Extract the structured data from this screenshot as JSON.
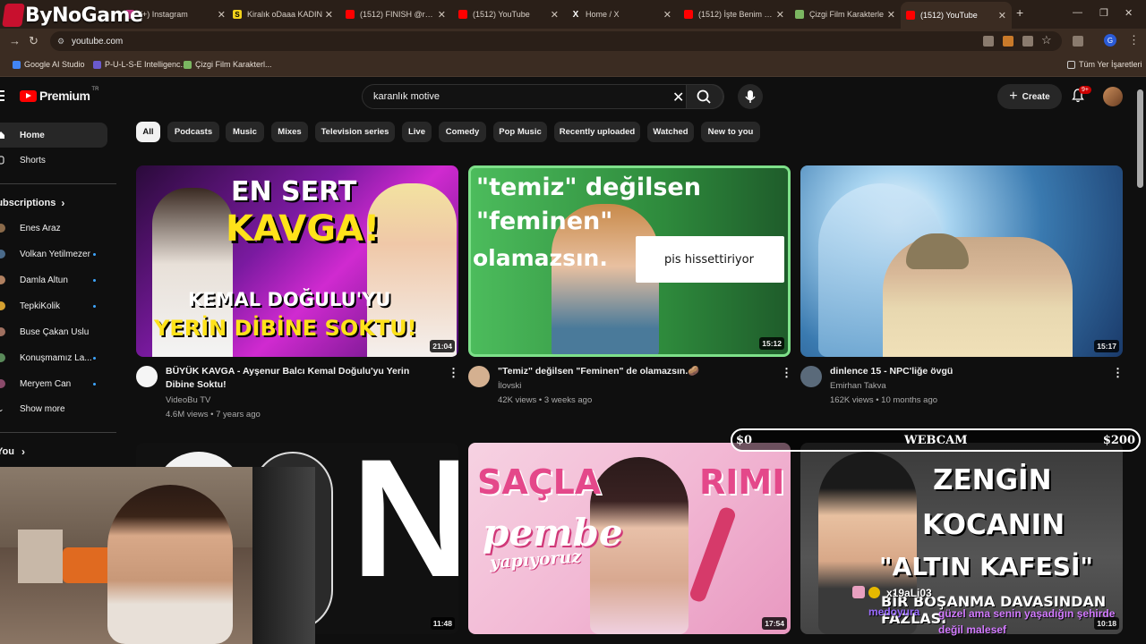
{
  "overlay_logo": "ByNoGame",
  "browser": {
    "tabs": [
      {
        "label": "(+) Instagram",
        "icon": "instagram-icon"
      },
      {
        "label": "Kiralık oDaaa KADIN",
        "icon": "s-icon"
      },
      {
        "label": "(1512) FINISH @rosel",
        "icon": "youtube-icon"
      },
      {
        "label": "(1512) YouTube",
        "icon": "youtube-icon"
      },
      {
        "label": "Home / X",
        "icon": "x-icon"
      },
      {
        "label": "(1512) İşte Benim Stil",
        "icon": "youtube-icon"
      },
      {
        "label": "Çizgi Film Karakterle",
        "icon": "cartoon-icon"
      },
      {
        "label": "(1512) YouTube",
        "icon": "youtube-icon"
      }
    ],
    "new_tab": "+",
    "url": "youtube.com",
    "profile_initial": "G",
    "bookmarks": [
      "Google AI Studio",
      "P-U-L-S-E Intelligenc...",
      "Çizgi Film Karakterl..."
    ],
    "all_bookmarks": "Tüm Yer İşaretleri"
  },
  "youtube": {
    "logo_text": "Premium",
    "region": "TR",
    "search_query": "karanlık motive",
    "create_label": "Create",
    "notif_count": "9+",
    "sidebar": {
      "main": [
        "Home",
        "Shorts"
      ],
      "subscriptions_title": "Subscriptions",
      "subscriptions": [
        "Enes Araz",
        "Volkan Yetilmezer",
        "Damla Altun",
        "TepkiKolik",
        "Buse Çakan Uslu",
        "Konuşmamız La...",
        "Meryem Can"
      ],
      "show_more": "Show more",
      "you_title": "You"
    },
    "chips": [
      "All",
      "Podcasts",
      "Music",
      "Mixes",
      "Television series",
      "Live",
      "Comedy",
      "Pop Music",
      "Recently uploaded",
      "Watched",
      "New to you"
    ],
    "videos": [
      {
        "title": "BÜYÜK KAVGA - Ayşenur Balcı Kemal Doğulu'yu Yerin Dibine Soktu!",
        "channel": "VideoBu TV",
        "meta": "4.6M views • 7 years ago",
        "duration": "21:04",
        "thumb_text": [
          "EN SERT",
          "KAVGA!",
          "KEMAL DOĞULU'YU",
          "YERİN DİBİNE SOKTU!"
        ]
      },
      {
        "title": "\"Temiz\" değilsen \"Feminen\" de olamazsın.🥔",
        "channel": "İlovski",
        "meta": "42K views • 3 weeks ago",
        "duration": "15:12",
        "thumb_text": [
          "\"temiz\" değilsen",
          "\"feminen\"",
          "olamazsın.",
          "pis hissettiriyor"
        ]
      },
      {
        "title": "dinlence 15 - NPC'liğe övgü",
        "channel": "Emirhan Takva",
        "meta": "162K views • 10 months ago",
        "duration": "15:17",
        "thumb_text": []
      },
      {
        "title": "",
        "channel": "",
        "meta": "",
        "duration": "11:48",
        "thumb_text": [
          "N"
        ]
      },
      {
        "title": "",
        "channel": "",
        "meta": "",
        "duration": "17:54",
        "thumb_text": [
          "SAÇLA",
          "RIMI",
          "pembe",
          "yapıyoruz"
        ]
      },
      {
        "title": "",
        "channel": "",
        "meta": "",
        "duration": "10:18",
        "thumb_text": [
          "ZENGİN",
          "KOCANIN",
          "\"ALTIN KAFESİ\"",
          "BİR BOŞANMA DAVASINDAN FAZLASI"
        ]
      }
    ]
  },
  "stream_overlay": {
    "goal_left": "$0",
    "goal_center": "WEBCAM",
    "goal_right": "$200",
    "chat_user1": "x19aLi03",
    "chat_user2": "medoyura",
    "chat_message": "güzel ama senin yaşadığın şehirde değil malesef"
  }
}
